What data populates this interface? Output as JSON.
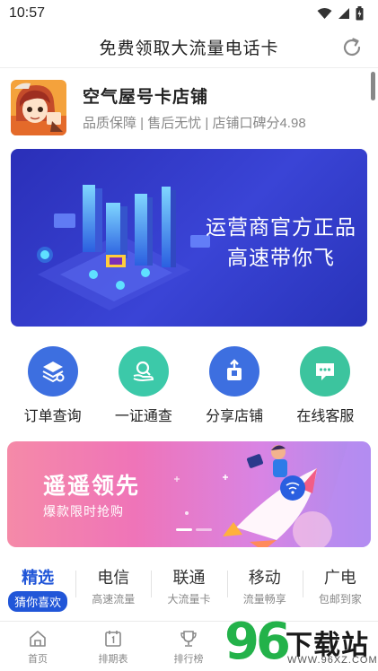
{
  "status_bar": {
    "time": "10:57"
  },
  "header": {
    "title": "免费领取大流量电话卡"
  },
  "shop": {
    "name": "空气屋号卡店铺",
    "description": "品质保障 | 售后无忧 | 店铺口碑分4.98"
  },
  "banner": {
    "line1": "运营商官方正品",
    "line2": "高速带你飞"
  },
  "actions": [
    {
      "label": "订单查询",
      "icon": "order-search-icon",
      "color": "#3d6fe0"
    },
    {
      "label": "一证通查",
      "icon": "id-check-icon",
      "color": "#3cc9a9"
    },
    {
      "label": "分享店铺",
      "icon": "share-icon",
      "color": "#3d6fe0"
    },
    {
      "label": "在线客服",
      "icon": "chat-icon",
      "color": "#3cc49e"
    }
  ],
  "promo": {
    "title": "遥遥领先",
    "subtitle": "爆款限时抢购"
  },
  "tabs": [
    {
      "title": "精选",
      "subtitle": "猜你喜欢",
      "active": true
    },
    {
      "title": "电信",
      "subtitle": "高速流量"
    },
    {
      "title": "联通",
      "subtitle": "大流量卡"
    },
    {
      "title": "移动",
      "subtitle": "流量畅享"
    },
    {
      "title": "广电",
      "subtitle": "包邮到家"
    }
  ],
  "bottom_nav": [
    {
      "label": "首页",
      "icon": "home-icon"
    },
    {
      "label": "排期表",
      "icon": "calendar-icon"
    },
    {
      "label": "排行榜",
      "icon": "trophy-icon"
    }
  ],
  "watermark": {
    "digits": "96",
    "name": "下载站",
    "url": "WWW.96XZ.COM"
  },
  "colors": {
    "accent": "#2156d8",
    "banner_bg": "#2f3ac8",
    "muted_text": "#888888"
  }
}
